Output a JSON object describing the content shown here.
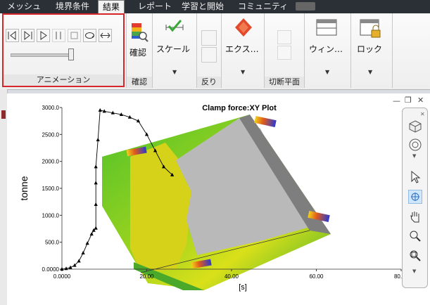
{
  "tabs": [
    "メッシュ",
    "境界条件",
    "結果",
    "レポート",
    "学習と開始",
    "コミュニティ"
  ],
  "ribbon": {
    "animation_group": "アニメーション",
    "check_label": "確認",
    "check_group": "確認",
    "scale_label": "スケール",
    "warp_group": "反り",
    "export_label": "エクス…",
    "section_group": "切断平面",
    "window_label": "ウィン…",
    "lock_label": "ロック"
  },
  "chart_data": {
    "type": "line",
    "title": "Clamp force:XY Plot",
    "xlabel": "[s]",
    "ylabel": "tonne",
    "xlim": [
      0,
      80
    ],
    "ylim": [
      0,
      3000
    ],
    "x_ticks": [
      "0.0000",
      "20.00",
      "40.00",
      "60.00",
      "80.00"
    ],
    "y_ticks": [
      "0.0000",
      "500.0",
      "1000.0",
      "1500.0",
      "2000.0",
      "2500.0",
      "3000.0"
    ],
    "series": [
      {
        "x": [
          0,
          1,
          2,
          3,
          4,
          5,
          6,
          7,
          7.5,
          8,
          8,
          8,
          8,
          8.5,
          9,
          10,
          12,
          14,
          16,
          18,
          20,
          22,
          24,
          26
        ],
        "y": [
          0,
          10,
          30,
          70,
          150,
          300,
          480,
          650,
          720,
          760,
          1200,
          1600,
          1900,
          2400,
          2950,
          2930,
          2900,
          2870,
          2820,
          2750,
          2500,
          2200,
          1900,
          1750
        ]
      }
    ]
  },
  "colors": {
    "accent_red": "#d6262b",
    "tab_bg": "#2b2f36"
  }
}
